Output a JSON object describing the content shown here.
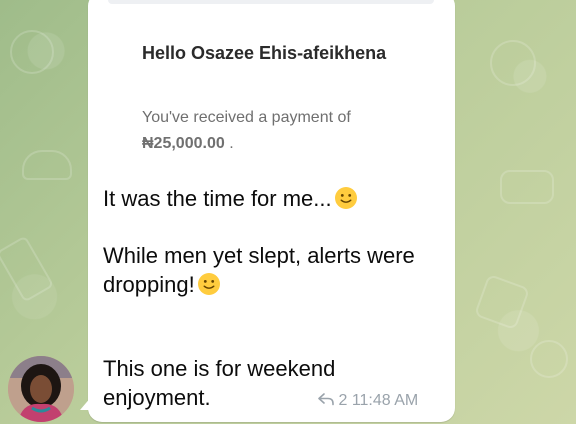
{
  "message": {
    "email_preview": {
      "greeting": "Hello Osazee Ehis-afeikhena",
      "payment_text": "You've received a payment of",
      "amount": "₦25,000.00",
      "amount_suffix": "."
    },
    "lines": [
      "It was the time for me...",
      "While men yet slept, alerts were dropping!",
      "This one is for weekend enjoyment."
    ],
    "emoji": "slightly-smiling-face",
    "reply_count": "2",
    "time": "11:48 AM"
  },
  "colors": {
    "wallpaper": "#a9c393",
    "bubble": "#ffffff",
    "meta": "#9aa3ab"
  }
}
